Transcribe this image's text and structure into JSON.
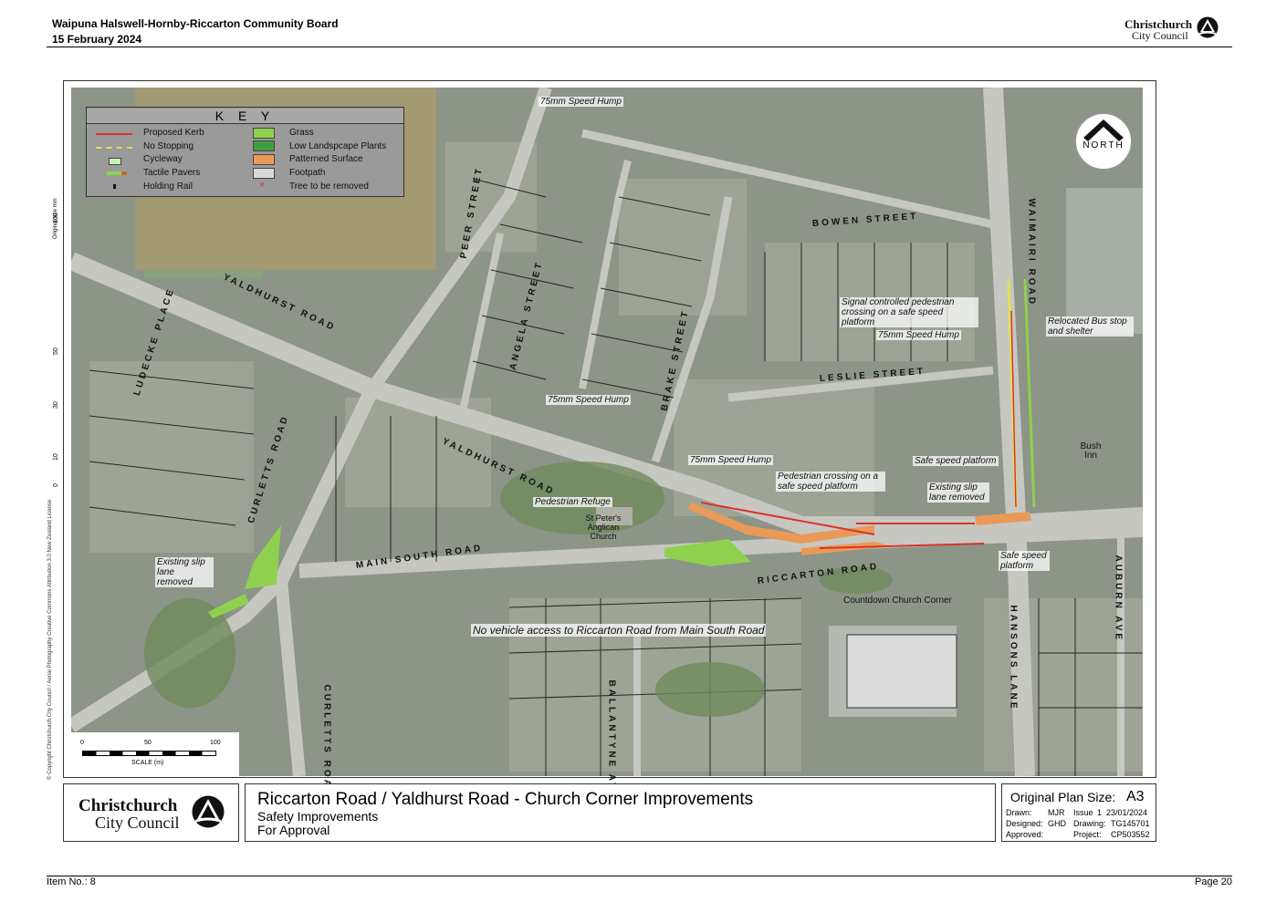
{
  "header": {
    "board": "Waipuna Halswell-Hornby-Riccarton Community Board",
    "date": "15 February 2024",
    "brand_line1": "Christchurch",
    "brand_line2": "City Council"
  },
  "footer": {
    "item": "Item No.: 8",
    "page": "Page 20"
  },
  "key": {
    "title": "K E Y",
    "left": [
      "Proposed Kerb",
      "No Stopping",
      "Cycleway",
      "Tactile Pavers",
      "Holding Rail"
    ],
    "right": [
      "Grass",
      "Low Landspcape Plants",
      "Patterned Surface",
      "Footpath",
      "Tree to be removed"
    ],
    "colors": {
      "kerb": "#d9342b",
      "grass": "#8fd14f",
      "plants": "#3f9e3f",
      "patterned": "#e99a58",
      "footpath": "#d8d8d8"
    }
  },
  "north": "NORTH",
  "roads": {
    "bowen": "BOWEN STREET",
    "waimairi": "WAIMAIRI ROAD",
    "leslie": "LESLIE STREET",
    "peer": "PEER STREET",
    "angela": "ANGELA STREET",
    "brake": "BRAKE STREET",
    "yaldhurst1": "YALDHURST ROAD",
    "yaldhurst2": "YALDHURST ROAD",
    "ludecke": "LUDECKE PLACE",
    "curletts1": "CURLETTS ROAD",
    "curletts2": "CURLETTS ROAD",
    "mainsouth": "MAIN SOUTH ROAD",
    "riccarton": "RICCARTON ROAD",
    "hansons": "HANSONS LANE",
    "auburn": "AUBURN AVE",
    "ballantyne": "BALLANTYNE AVENUE"
  },
  "annotations": {
    "hump1": "75mm Speed Hump",
    "hump2": "75mm Speed Hump",
    "hump3": "75mm Speed Hump",
    "hump4": "75mm Speed Hump",
    "signal": "Signal controlled pedestrian crossing on a safe speed platform",
    "busstop": "Relocated Bus stop and shelter",
    "safe1": "Safe speed platform",
    "slip1": "Existing slip lane removed",
    "pedcross": "Pedestrian crossing on a safe speed platform",
    "refuge": "Pedestrian Refuge",
    "slip2": "Existing slip lane removed",
    "safe2": "Safe speed platform",
    "novehicle": "No vehicle access to Riccarton Road from Main South Road"
  },
  "places": {
    "church": "St Peter's Anglican Church",
    "bush": "Bush Inn",
    "countdown": "Countdown Church Corner"
  },
  "scale": {
    "ticks": [
      "0",
      "50",
      "100"
    ],
    "label": "SCALE (m)"
  },
  "side_ruler": {
    "label": "Original size mm",
    "marks": [
      "100",
      "50",
      "30",
      "10",
      "0"
    ]
  },
  "copyright": "© Copyright Christchurch City Council / Aerial Photography Creative Commons Attribution 3.0 New Zealand License",
  "titleblock": {
    "logo1": "Christchurch",
    "logo2": "City Council",
    "title": "Riccarton Road / Yaldhurst Road - Church Corner Improvements",
    "sub1": "Safety Improvements",
    "sub2": "For Approval",
    "size_label": "Original Plan Size:",
    "size_value": "A3",
    "drawn_l": "Drawn:",
    "drawn_v": "MJR",
    "designed_l": "Designed:",
    "designed_v": "GHD",
    "approved_l": "Approved:",
    "issue_l": "Issue",
    "issue_v": "1",
    "issue_date": "23/01/2024",
    "drawing_l": "Drawing:",
    "drawing_v": "TG145701",
    "project_l": "Project:",
    "project_v": "CP503552"
  }
}
